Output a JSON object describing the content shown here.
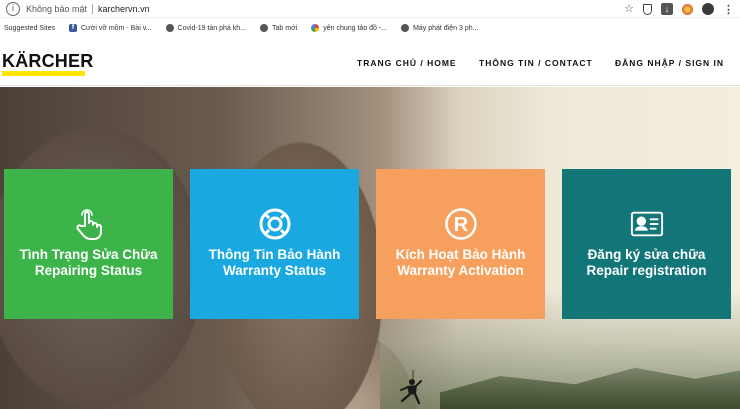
{
  "browser": {
    "security_label": "Không bảo mật",
    "url": "karchervn.vn",
    "bookmarks": [
      {
        "label": "Suggested Sites",
        "icon": "none"
      },
      {
        "label": "Cười vỡ mồm - Bài v...",
        "icon": "facebook-icon"
      },
      {
        "label": "Covid-19 tàn phá kh...",
        "icon": "globe-icon"
      },
      {
        "label": "Tab mới",
        "icon": "globe-icon"
      },
      {
        "label": "yên chung tảo đồ -...",
        "icon": "google-icon"
      },
      {
        "label": "Máy phát điện 3 ph...",
        "icon": "globe-icon"
      }
    ]
  },
  "site": {
    "logo": "KÄRCHER",
    "brand_yellow": "#ffe600",
    "nav": {
      "home": "TRANG CHỦ / HOME",
      "contact": "THÔNG TIN / CONTACT",
      "signin": "ĐĂNG NHẬP / SIGN IN"
    }
  },
  "tiles": [
    {
      "line1": "Tình Trạng Sửa Chữa",
      "line2": "Repairing Status",
      "color": "#3db44a",
      "icon": "pointer-hand-icon"
    },
    {
      "line1": "Thông Tin Bảo Hành",
      "line2": "Warranty Status",
      "color": "#1aa8e0",
      "icon": "lifebuoy-icon"
    },
    {
      "line1": "Kích Hoạt Bảo Hành",
      "line2": "Warranty Activation",
      "color": "#f7a05e",
      "icon": "registered-icon"
    },
    {
      "line1": "Đăng ký sửa chữa",
      "line2": "Repair registration",
      "color": "#127578",
      "icon": "id-card-icon"
    }
  ]
}
